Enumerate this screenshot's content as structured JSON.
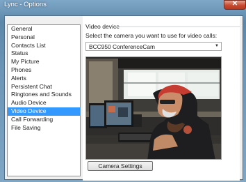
{
  "window": {
    "title": "Lync - Options"
  },
  "nav": {
    "items": [
      {
        "label": "General"
      },
      {
        "label": "Personal"
      },
      {
        "label": "Contacts List"
      },
      {
        "label": "Status"
      },
      {
        "label": "My Picture"
      },
      {
        "label": "Phones"
      },
      {
        "label": "Alerts"
      },
      {
        "label": "Persistent Chat"
      },
      {
        "label": "Ringtones and Sounds"
      },
      {
        "label": "Audio Device"
      },
      {
        "label": "Video Device"
      },
      {
        "label": "Call Forwarding"
      },
      {
        "label": "File Saving"
      }
    ],
    "selected": "Video Device"
  },
  "video_device": {
    "section_title": "Video device",
    "prompt": "Select the camera you want to use for video calls:",
    "camera_selected": "BCC950 ConferenceCam",
    "settings_button": "Camera Settings"
  },
  "colors": {
    "selection": "#3399ff",
    "title_bar": "#6d97b8",
    "close_button": "#c74a2f"
  }
}
